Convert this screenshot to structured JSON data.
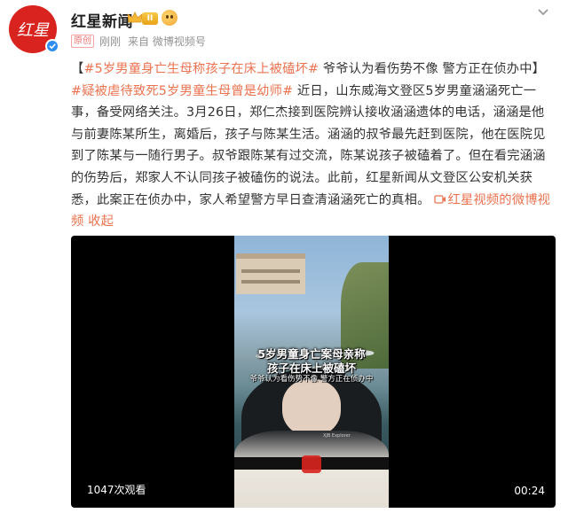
{
  "author": {
    "name": "红星新闻",
    "avatar_glyph": "红星",
    "level_badge": "II",
    "icons": [
      "crown-icon",
      "level-badge-icon",
      "emoji-badge-icon",
      "verified-icon",
      "chevron-down-icon"
    ]
  },
  "meta": {
    "original_tag": "原创",
    "time": "刚刚",
    "source": "来自 微博视频号"
  },
  "post": {
    "bracket_open": "【",
    "hashtag1": "#5岁男童身亡生母称孩子在床上被磕坏#",
    "text1": " 爷爷认为看伤势不像  警方正在侦办中",
    "bracket_close": "】",
    "hashtag2": "#疑被虐待致死5岁男童生母曾是幼师#",
    "body": " 近日，山东威海文登区5岁男童涵涵死亡一事，备受网络关注。3月26日，郑仁杰接到医院辨认接收涵涵遗体的电话，涵涵是他与前妻陈某所生，离婚后，孩子与陈某生活。涵涵的叔爷最先赶到医院，他在医院见到了陈某与一随行男子。叔爷跟陈某有过交流，陈某说孩子被磕着了。但在看完涵涵的伤势后，郑家人不认同孩子被磕伤的说法。此前，红星新闻从文登区公安机关获悉，此案正在侦办中，家人希望警方早日查清涵涵死亡的真相。",
    "link_text": "红星视频的微博视频",
    "collapse": "收起"
  },
  "video": {
    "overlay_title_line1": "5岁男童身亡案母亲称",
    "overlay_title_line2": "孩子在床上被磕坏",
    "overlay_subtitle": "爷爷认为看伤势不像  警方正在侦办中",
    "jacket_brand": "XJB Explorer",
    "views": "1047次观看",
    "duration": "00:24"
  },
  "colors": {
    "accent": "#eb7350",
    "brand_red": "#d9231f",
    "verified_blue": "#2d8cf0",
    "meta_gray": "#939393"
  }
}
